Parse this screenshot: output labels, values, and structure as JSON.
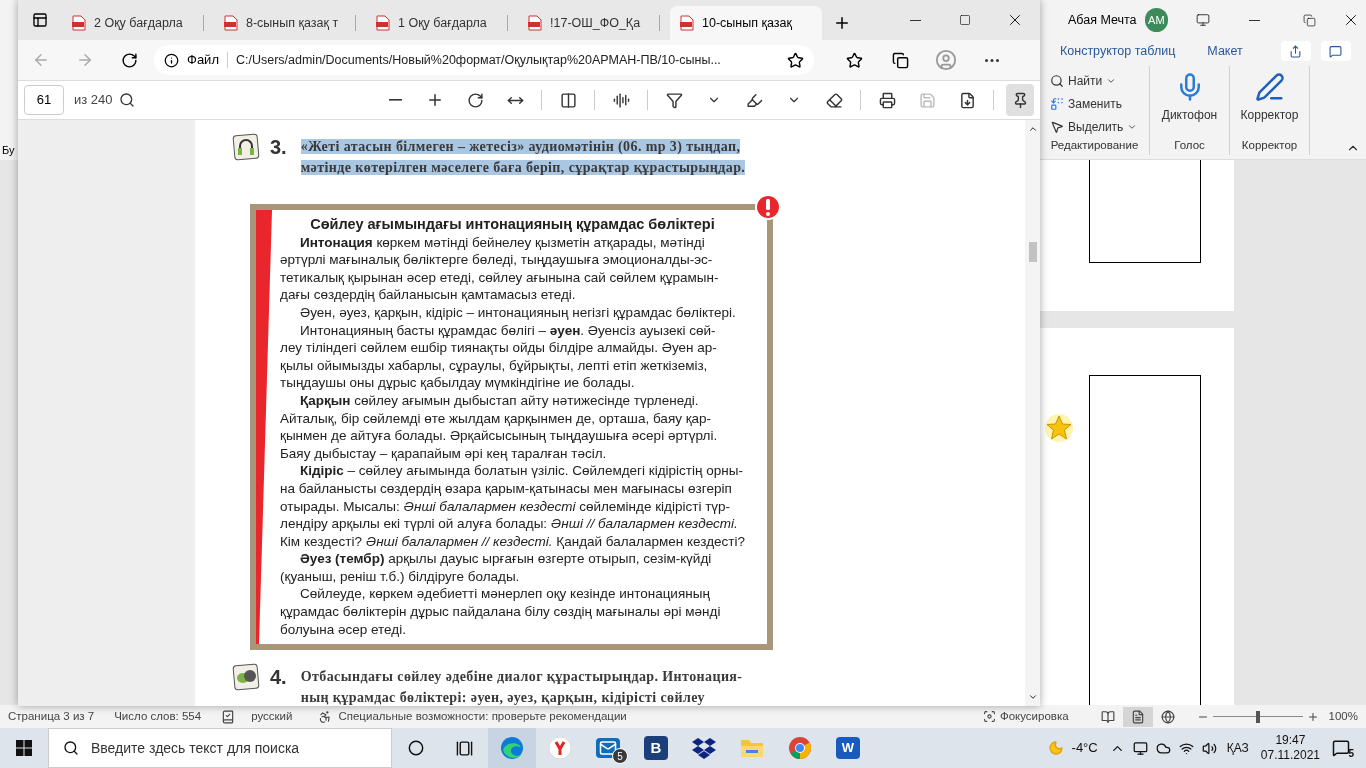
{
  "word": {
    "left_ribbon_text": "Бу",
    "user": "Абая Мечта",
    "initials": "AM",
    "ribbon_tabs": [
      "Конструктор таблиц",
      "Макет"
    ],
    "edit_commands": [
      {
        "kind": "find",
        "label": "Найти",
        "dropdown": true
      },
      {
        "kind": "replace",
        "label": "Заменить",
        "dropdown": false
      },
      {
        "kind": "select",
        "label": "Выделить",
        "dropdown": true
      }
    ],
    "groups": [
      {
        "kind": "edit",
        "label": "Редактирование"
      },
      {
        "kind": "voice",
        "label": "Голос",
        "button": "Диктофон"
      },
      {
        "kind": "editor",
        "label": "Корректор",
        "button": "Корректор"
      }
    ],
    "status": {
      "page": "Страница 3 из 7",
      "words": "Число слов: 554",
      "language": "русский",
      "accessibility": "Специальные возможности: проверьте рекомендации",
      "focus": "Фокусировка",
      "views": [
        {
          "kind": "read",
          "selected": false
        },
        {
          "kind": "print",
          "selected": true
        },
        {
          "kind": "web",
          "selected": false
        }
      ],
      "zoom": {
        "level": 0.5,
        "reading": "100%"
      }
    }
  },
  "edge": {
    "tabs": [
      {
        "label": "2 Оқу бағдарла",
        "selected": false
      },
      {
        "label": "8-сынып қазақ т",
        "selected": false
      },
      {
        "label": "1 Оқу бағдарла",
        "selected": false
      },
      {
        "label": "!17-ОШ_ФО_Қа",
        "selected": false
      },
      {
        "label": "10-сынып қазақ",
        "selected": true
      }
    ],
    "address": {
      "scheme": "Файл",
      "url": "C:/Users/admin/Documents/Новый%20формат/Оқулықтар%20АРМАН-ПВ/10-сыны..."
    },
    "pdf_toolbar": {
      "page": "61",
      "total": "из 240",
      "pinned": true
    },
    "page": {
      "items": [
        {
          "kind": "listen",
          "number": "3.",
          "text": "«Жеті атасын білмеген – жетесіз» аудиомәтінін (06. mp 3) тыңдап,\nмәтінде көтерілген мәселеге баға беріп, сұрақтар құрастырыңдар.",
          "highlighted": true
        },
        {
          "kind": "note",
          "title": "Сөйлеу ағымындағы интонацияның құрамдас бөліктері",
          "paragraphs": [
            "**Интонация** көркем мәтінді бейнелеу қызметін атқарады, мәтінді\nәртүрлі мағыналық бөліктерге бөледі, тыңдаушыға эмоционалды-эс-\nтетикалық қырынан әсер етеді, сөйлеу ағынына сай сөйлем құрамын-\nдағы сөздердің байланысын қамтамасыз етеді.",
            "Әуен, әуез, қарқын, кідіріс – интонацияның негізгі құрамдас бөліктері.",
            "Интонацияның басты құрамдас бөлігі – **әуен**. Әуенсіз ауызекі сөй-\nлеу тіліндегі сөйлем ешбір тиянақты ойды білдіре алмайды. Әуен ар-\nқылы ойымызды хабарлы, сұраулы, бұйрықты, лепті етіп жеткіземіз,\nтыңдаушы оны дұрыс қабылдау мүмкіндігіне ие болады.",
            "**Қарқын** сөйлеу ағымын дыбыстап айту нәтижесінде түрленеді.\nАйталық, бір сөйлемді өте жылдам қарқынмен де, орташа, баяу қар-\nқынмен де айтуға болады. Әрқайсысының тыңдаушыға әсері әртүрлі.\nБаяу дыбыстау – қарапайым әрі кең таралған тәсіл.",
            "**Кідіріс** – сөйлеу ағымында болатын үзіліс. Сөйлемдегі кідірістің орны-\nна байланысты сөздердің өзара қарым-қатынасы мен мағынасы өзгеріп\nотырады. Мысалы: *Әнші балалармен кездесті* сөйлемінде кідірісті түр-\nлендіру арқылы екі түрлі ой алуға болады: *Әнші // балалармен кездесті.*\nКім кездесті? *Әнші балалармен // кездесті.* Қандай балалармен кездесті?",
            "**Әуез (тембр)** арқылы дауыс ырғағын өзгерте отырып, сезім-күйді\n(қуаныш, реніш т.б.) білдіруге болады.",
            "Сөйлеуде, көркем әдебиетті мәнерлеп оқу кезінде интонацияның\nқұрамдас бөліктерін дұрыс пайдалана білу сөздің мағыналы әрі мәнді\nболуына әсер етеді."
          ]
        },
        {
          "kind": "dialog",
          "number": "4.",
          "text": "Отбасындағы сөйлеу әдебіне диалог құрастырыңдар. Интонация-\nның құрамдас бөліктері: әуен, әуез, қарқын, кідірісті сөйлеу",
          "highlighted": false
        }
      ]
    }
  },
  "taskbar": {
    "search_placeholder": "Введите здесь текст для поиска",
    "apps": [
      {
        "kind": "edge",
        "selected": true
      },
      {
        "kind": "yandex",
        "selected": false
      },
      {
        "kind": "mail",
        "badge": "5",
        "selected": false
      },
      {
        "kind": "letter",
        "label": "B",
        "selected": false
      },
      {
        "kind": "dropbox",
        "selected": false
      },
      {
        "kind": "folder",
        "selected": false
      },
      {
        "kind": "chrome",
        "selected": false
      },
      {
        "kind": "word",
        "label": "W",
        "selected": false
      }
    ],
    "weather": "-4°C",
    "language": "ҚАЗ",
    "time": "19:47",
    "date": "07.11.2021",
    "notifications": "5"
  }
}
